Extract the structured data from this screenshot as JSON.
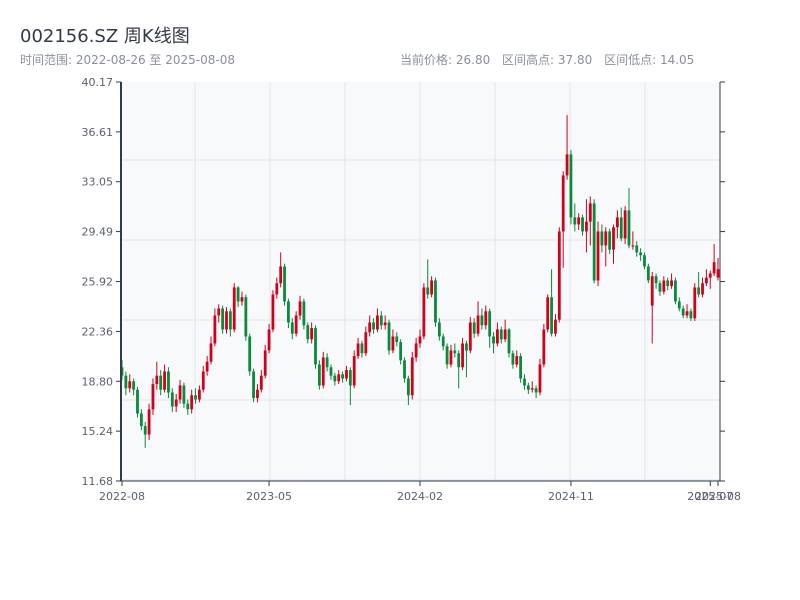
{
  "header": {
    "title": "002156.SZ 周K线图",
    "range_label": "时间范围: 2022-08-26 至 2025-08-08",
    "current_price": "当前价格: 26.80",
    "range_high": "区间高点: 37.80",
    "range_low": "区间低点: 14.05"
  },
  "colors": {
    "up": "#d0021b",
    "down": "#0a8a3a",
    "grid": "#e3e6ea",
    "plot_bg": "#f7f9fb",
    "axis": "#2f3b4a"
  },
  "chart_data": {
    "type": "candlestick",
    "title": "002156.SZ 周K线图",
    "frequency": "weekly",
    "start_date": "2022-08-26",
    "end_date": "2025-08-08",
    "ylim": [
      11.68,
      40.17
    ],
    "y_ticks": [
      "11.68",
      "15.24",
      "18.80",
      "22.36",
      "25.92",
      "29.49",
      "33.05",
      "36.61",
      "40.17"
    ],
    "x_ticks": [
      {
        "label": "2022-08",
        "date": "2022-08-26"
      },
      {
        "label": "2023-05",
        "date": "2023-05-19"
      },
      {
        "label": "2024-02",
        "date": "2024-02-16"
      },
      {
        "label": "2024-11",
        "date": "2024-11-15"
      },
      {
        "label": "2025-07",
        "date": "2025-07-25"
      },
      {
        "label": "2025-08",
        "date": "2025-08-08"
      }
    ],
    "grid": true,
    "ohlc_fields": [
      "open",
      "high",
      "low",
      "close"
    ],
    "candles": [
      [
        19.8,
        20.3,
        18.9,
        19.2
      ],
      [
        19.2,
        19.5,
        17.8,
        18.3
      ],
      [
        18.3,
        19.3,
        18.0,
        18.8
      ],
      [
        18.8,
        19.0,
        17.8,
        18.2
      ],
      [
        18.2,
        18.4,
        16.2,
        16.5
      ],
      [
        16.5,
        16.8,
        15.3,
        15.6
      ],
      [
        15.6,
        15.9,
        14.05,
        15.0
      ],
      [
        15.0,
        17.2,
        14.6,
        16.8
      ],
      [
        16.8,
        19.0,
        16.4,
        18.6
      ],
      [
        18.6,
        20.2,
        18.2,
        19.2
      ],
      [
        19.2,
        19.6,
        17.8,
        18.2
      ],
      [
        18.2,
        20.0,
        18.0,
        19.5
      ],
      [
        19.5,
        19.8,
        17.6,
        18.0
      ],
      [
        18.0,
        18.3,
        16.6,
        17.0
      ],
      [
        17.0,
        17.9,
        16.6,
        17.5
      ],
      [
        17.5,
        18.9,
        17.2,
        18.5
      ],
      [
        18.5,
        18.7,
        16.9,
        17.2
      ],
      [
        17.2,
        17.5,
        16.4,
        16.8
      ],
      [
        16.8,
        18.2,
        16.5,
        17.8
      ],
      [
        17.8,
        18.3,
        17.2,
        17.5
      ],
      [
        17.5,
        18.5,
        17.3,
        18.2
      ],
      [
        18.2,
        19.9,
        18.0,
        19.5
      ],
      [
        19.5,
        20.6,
        19.2,
        20.2
      ],
      [
        20.2,
        22.0,
        20.0,
        21.5
      ],
      [
        21.5,
        24.0,
        21.3,
        23.5
      ],
      [
        23.5,
        24.3,
        23.0,
        24.0
      ],
      [
        24.0,
        24.2,
        22.2,
        22.5
      ],
      [
        22.5,
        24.1,
        22.2,
        23.8
      ],
      [
        23.8,
        24.0,
        22.0,
        22.5
      ],
      [
        22.5,
        25.8,
        22.3,
        25.5
      ],
      [
        25.5,
        25.6,
        24.1,
        24.5
      ],
      [
        24.5,
        25.2,
        24.2,
        24.8
      ],
      [
        24.8,
        25.0,
        21.7,
        22.0
      ],
      [
        22.0,
        22.2,
        19.2,
        19.5
      ],
      [
        19.5,
        19.7,
        17.3,
        17.6
      ],
      [
        17.6,
        18.6,
        17.3,
        18.2
      ],
      [
        18.2,
        19.6,
        18.0,
        19.2
      ],
      [
        19.2,
        21.4,
        19.0,
        21.0
      ],
      [
        21.0,
        22.9,
        20.8,
        22.5
      ],
      [
        22.5,
        25.3,
        22.3,
        25.0
      ],
      [
        25.0,
        26.2,
        24.7,
        25.8
      ],
      [
        25.8,
        28.0,
        25.5,
        27.0
      ],
      [
        27.0,
        27.2,
        24.2,
        24.5
      ],
      [
        24.5,
        24.7,
        22.6,
        23.0
      ],
      [
        23.0,
        23.3,
        21.8,
        22.2
      ],
      [
        22.2,
        23.8,
        22.0,
        23.5
      ],
      [
        23.5,
        24.9,
        23.2,
        24.5
      ],
      [
        24.5,
        24.7,
        22.5,
        22.8
      ],
      [
        22.8,
        23.0,
        21.5,
        21.8
      ],
      [
        21.8,
        23.0,
        21.5,
        22.6
      ],
      [
        22.6,
        22.8,
        19.7,
        20.0
      ],
      [
        20.0,
        20.3,
        18.2,
        18.5
      ],
      [
        18.5,
        20.9,
        18.3,
        20.5
      ],
      [
        20.5,
        20.8,
        19.5,
        19.8
      ],
      [
        19.8,
        20.0,
        18.9,
        19.2
      ],
      [
        19.2,
        19.4,
        18.5,
        18.8
      ],
      [
        18.8,
        19.6,
        18.6,
        19.3
      ],
      [
        19.3,
        19.5,
        18.7,
        19.0
      ],
      [
        19.0,
        19.9,
        18.8,
        19.6
      ],
      [
        19.6,
        19.8,
        17.1,
        18.5
      ],
      [
        18.5,
        21.0,
        18.3,
        20.6
      ],
      [
        20.6,
        21.9,
        20.4,
        21.5
      ],
      [
        21.5,
        21.7,
        20.5,
        20.8
      ],
      [
        20.8,
        22.7,
        20.6,
        22.3
      ],
      [
        22.3,
        23.5,
        22.0,
        23.0
      ],
      [
        23.0,
        23.3,
        22.2,
        22.5
      ],
      [
        22.5,
        24.0,
        22.3,
        23.5
      ],
      [
        23.5,
        23.8,
        22.5,
        22.8
      ],
      [
        22.8,
        23.5,
        22.5,
        23.0
      ],
      [
        23.0,
        23.2,
        20.7,
        21.0
      ],
      [
        21.0,
        22.5,
        20.8,
        22.0
      ],
      [
        22.0,
        22.3,
        21.3,
        21.6
      ],
      [
        21.6,
        21.8,
        20.0,
        20.3
      ],
      [
        20.3,
        20.5,
        18.7,
        19.0
      ],
      [
        19.0,
        19.2,
        17.1,
        17.8
      ],
      [
        17.8,
        20.9,
        17.5,
        20.5
      ],
      [
        20.5,
        21.9,
        20.2,
        21.5
      ],
      [
        21.5,
        22.5,
        21.2,
        22.0
      ],
      [
        22.0,
        25.8,
        21.8,
        25.5
      ],
      [
        25.5,
        27.5,
        24.7,
        25.0
      ],
      [
        25.0,
        26.3,
        24.8,
        26.0
      ],
      [
        26.0,
        26.2,
        22.7,
        23.0
      ],
      [
        23.0,
        23.3,
        21.7,
        22.0
      ],
      [
        22.0,
        22.2,
        21.0,
        21.3
      ],
      [
        21.3,
        21.5,
        19.7,
        20.0
      ],
      [
        20.0,
        21.4,
        19.8,
        21.0
      ],
      [
        21.0,
        21.5,
        20.5,
        20.8
      ],
      [
        20.8,
        21.0,
        18.3,
        19.8
      ],
      [
        19.8,
        21.9,
        19.6,
        21.5
      ],
      [
        21.5,
        21.7,
        19.1,
        21.0
      ],
      [
        21.0,
        23.4,
        20.8,
        23.0
      ],
      [
        23.0,
        23.3,
        21.9,
        22.2
      ],
      [
        22.2,
        24.5,
        22.0,
        23.5
      ],
      [
        23.5,
        24.0,
        22.5,
        22.8
      ],
      [
        22.8,
        24.2,
        22.5,
        23.8
      ],
      [
        23.8,
        24.0,
        21.2,
        22.0
      ],
      [
        22.0,
        22.3,
        20.8,
        21.5
      ],
      [
        21.5,
        23.0,
        21.3,
        22.5
      ],
      [
        22.5,
        22.7,
        21.5,
        21.8
      ],
      [
        21.8,
        23.2,
        21.6,
        22.5
      ],
      [
        22.5,
        22.6,
        20.5,
        20.8
      ],
      [
        20.8,
        21.0,
        19.7,
        20.0
      ],
      [
        20.0,
        21.0,
        19.8,
        20.6
      ],
      [
        20.6,
        20.8,
        18.7,
        19.0
      ],
      [
        19.0,
        19.3,
        18.2,
        18.5
      ],
      [
        18.5,
        18.7,
        17.9,
        18.2
      ],
      [
        18.2,
        18.8,
        18.0,
        18.3
      ],
      [
        18.3,
        18.5,
        17.6,
        18.0
      ],
      [
        18.0,
        20.4,
        17.8,
        20.0
      ],
      [
        20.0,
        22.9,
        19.8,
        22.5
      ],
      [
        22.5,
        25.0,
        22.3,
        24.8
      ],
      [
        24.8,
        26.8,
        22.0,
        22.2
      ],
      [
        22.2,
        23.6,
        22.0,
        23.2
      ],
      [
        23.2,
        29.8,
        23.0,
        29.5
      ],
      [
        29.5,
        33.8,
        26.9,
        33.5
      ],
      [
        33.5,
        37.8,
        33.2,
        35.0
      ],
      [
        35.0,
        35.3,
        30.0,
        30.5
      ],
      [
        30.5,
        31.5,
        29.5,
        30.0
      ],
      [
        30.0,
        30.8,
        29.6,
        30.5
      ],
      [
        30.5,
        30.7,
        29.2,
        29.5
      ],
      [
        29.5,
        31.8,
        28.0,
        30.2
      ],
      [
        30.2,
        32.0,
        28.5,
        31.5
      ],
      [
        31.5,
        31.8,
        25.8,
        26.0
      ],
      [
        26.0,
        30.2,
        25.6,
        29.5
      ],
      [
        29.5,
        30.0,
        28.0,
        28.5
      ],
      [
        28.5,
        29.8,
        27.0,
        29.5
      ],
      [
        29.5,
        29.7,
        27.9,
        28.2
      ],
      [
        28.2,
        30.0,
        27.2,
        29.8
      ],
      [
        29.8,
        31.0,
        29.0,
        30.5
      ],
      [
        30.5,
        31.2,
        28.8,
        29.0
      ],
      [
        29.0,
        31.3,
        28.6,
        31.0
      ],
      [
        31.0,
        32.6,
        28.3,
        28.5
      ],
      [
        28.5,
        29.5,
        28.2,
        28.5
      ],
      [
        28.5,
        28.8,
        27.7,
        28.0
      ],
      [
        28.0,
        28.3,
        27.4,
        27.8
      ],
      [
        27.8,
        28.0,
        26.8,
        27.0
      ],
      [
        27.0,
        27.2,
        25.8,
        26.0
      ],
      [
        24.2,
        26.6,
        21.5,
        26.3
      ],
      [
        26.3,
        26.5,
        25.4,
        25.8
      ],
      [
        25.8,
        26.0,
        24.9,
        25.2
      ],
      [
        25.2,
        26.3,
        25.0,
        26.0
      ],
      [
        26.0,
        26.2,
        25.3,
        25.6
      ],
      [
        25.6,
        26.5,
        25.4,
        26.0
      ],
      [
        26.0,
        26.2,
        24.3,
        24.5
      ],
      [
        24.5,
        24.8,
        23.8,
        24.0
      ],
      [
        24.0,
        24.2,
        23.3,
        23.5
      ],
      [
        23.5,
        24.3,
        23.3,
        23.8
      ],
      [
        23.8,
        24.0,
        23.1,
        23.3
      ],
      [
        23.3,
        25.8,
        23.1,
        25.5
      ],
      [
        25.5,
        26.6,
        24.8,
        25.0
      ],
      [
        25.0,
        26.2,
        24.8,
        25.8
      ],
      [
        25.8,
        26.8,
        25.6,
        26.2
      ],
      [
        26.2,
        26.7,
        25.4,
        26.5
      ],
      [
        26.5,
        28.6,
        26.3,
        27.3
      ],
      [
        26.2,
        27.6,
        26.0,
        26.8
      ]
    ]
  }
}
